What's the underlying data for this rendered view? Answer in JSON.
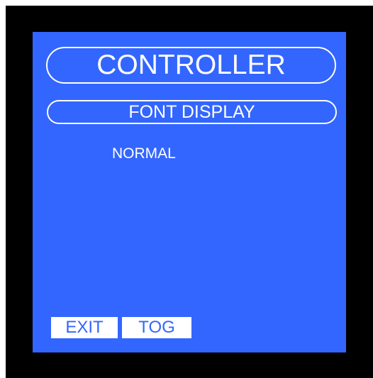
{
  "colors": {
    "bezel": "#000000",
    "screen": "#3366ff",
    "text": "#ffffff",
    "button_bg": "#ffffff",
    "button_text": "#3366ff"
  },
  "header": {
    "title": "CONTROLLER",
    "subtitle": "FONT DISPLAY"
  },
  "content": {
    "mode_value": "NORMAL"
  },
  "softkeys": {
    "exit_label": "EXIT",
    "tog_label": "TOG"
  }
}
